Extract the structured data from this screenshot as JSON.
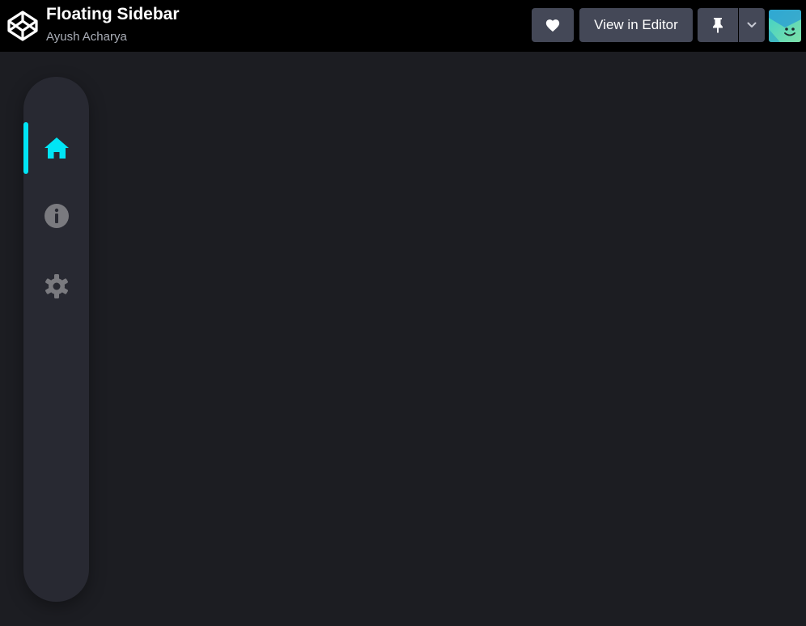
{
  "header": {
    "title": "Floating Sidebar",
    "author": "Ayush Acharya",
    "logo_icon": "codepen-logo-icon",
    "buttons": {
      "heart_icon": "heart-icon",
      "view_editor_label": "View in Editor",
      "pin_icon": "pin-icon",
      "more_icon": "chevron-down-icon"
    },
    "avatar_icon": "smiley-avatar"
  },
  "sidebar": {
    "items": [
      {
        "id": "home",
        "icon": "home-icon",
        "active": true
      },
      {
        "id": "info",
        "icon": "info-icon",
        "active": false
      },
      {
        "id": "settings",
        "icon": "gear-icon",
        "active": false
      }
    ]
  },
  "colors": {
    "background": "#1c1d22",
    "topbar": "#000000",
    "sidebar": "#282932",
    "accent": "#00e5f5",
    "icon_inactive": "#7a7a7f",
    "button": "#444857"
  }
}
